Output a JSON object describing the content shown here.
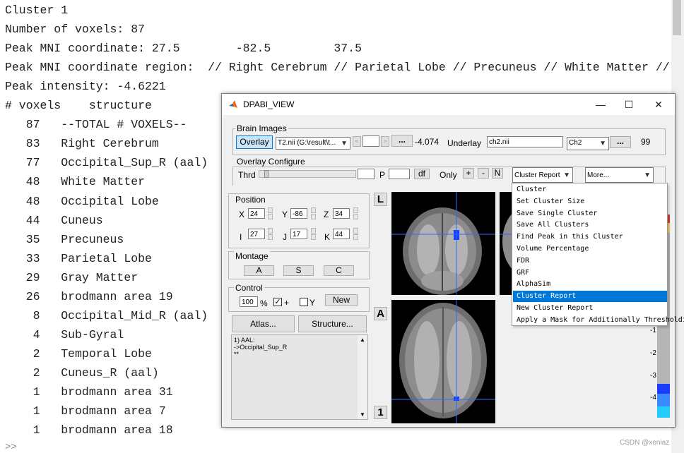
{
  "console": {
    "lines": [
      "Cluster 1",
      "Number of voxels: 87",
      "Peak MNI coordinate: 27.5        -82.5         37.5",
      "Peak MNI coordinate region:  // Right Cerebrum // Parietal Lobe // Precuneus // White Matter // undef",
      "Peak intensity: -4.6221",
      "# voxels    structure",
      "   87   --TOTAL # VOXELS--",
      "   83   Right Cerebrum",
      "   77   Occipital_Sup_R (aal)",
      "   48   White Matter",
      "   48   Occipital Lobe",
      "   44   Cuneus",
      "   35   Precuneus",
      "   33   Parietal Lobe",
      "   29   Gray Matter",
      "   26   brodmann area 19",
      "    8   Occipital_Mid_R (aal)",
      "    4   Sub-Gyral",
      "    2   Temporal Lobe",
      "    2   Cuneus_R (aal)",
      "    1   brodmann area 31",
      "    1   brodmann area 7",
      "    1   brodmann area 18"
    ],
    "prompt": ">>"
  },
  "window": {
    "title": "DPABI_VIEW",
    "minimize": "—",
    "maximize": "☐",
    "close": "✕"
  },
  "brain_images": {
    "label": "Brain Images",
    "overlay_btn": "Overlay",
    "overlay_file": "T2.nii (G:\\result\\t...",
    "prev_btn": "<",
    "next_btn": ">",
    "dots1": "...",
    "value": "-4.074",
    "underlay_label": "Underlay",
    "underlay_file": "ch2.nii",
    "underlay_select": "Ch2",
    "dots2": "...",
    "opacity": "99"
  },
  "overlay_configure": {
    "label": "Overlay Configure",
    "thrd": "Thrd",
    "p": "P",
    "df": "df",
    "only": "Only",
    "plus": "+",
    "minus": "-",
    "n": "N"
  },
  "cluster_select": "Cluster Report",
  "more_select": "More...",
  "menu_items": [
    "Cluster",
    "Set Cluster Size",
    "Save Single Cluster",
    "Save All Clusters",
    "Find Peak in this Cluster",
    "Volume Percentage",
    "FDR",
    "GRF",
    "AlphaSim",
    "Cluster Report",
    "New Cluster Report",
    "Apply a Mask for Additionally Thresholding"
  ],
  "menu_selected": "Cluster Report",
  "position": {
    "label": "Position",
    "x_label": "X",
    "x": "24",
    "y_label": "Y",
    "y": "-86",
    "z_label": "Z",
    "z": "34",
    "i_label": "I",
    "i": "27",
    "j_label": "J",
    "j": "17",
    "k_label": "K",
    "k": "44"
  },
  "montage": {
    "label": "Montage",
    "a": "A",
    "s": "S",
    "c": "C"
  },
  "control": {
    "label": "Control",
    "percent": "100",
    "pct_sign": "%",
    "plus_label": "+",
    "y_label": "Y",
    "new_btn": "New"
  },
  "atlas_btn": "Atlas...",
  "structure_btn": "Structure...",
  "atlas_text": [
    "1) AAL:",
    "->Occipital_Sup_R",
    "**"
  ],
  "view_labels": {
    "l": "L",
    "a": "A",
    "one": "1"
  },
  "colorbar_ticks": [
    "-1",
    "-2",
    "-3",
    "-4"
  ],
  "watermark": "CSDN @xeniaz",
  "colors": {
    "selection": "#0078d7",
    "overlay_blue": "#1a3cff",
    "crosshair": "#2a6cff"
  }
}
